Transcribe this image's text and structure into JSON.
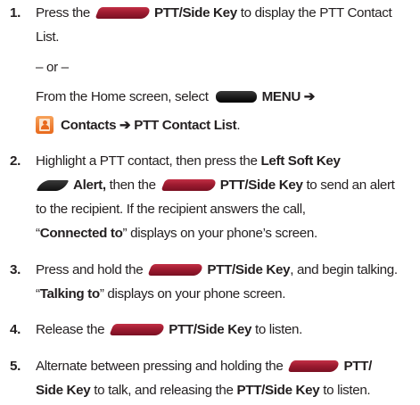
{
  "steps": [
    {
      "number": "1.",
      "line1_text": "Press the",
      "line1_bold": "PTT/Side Key",
      "line1_tail": "to display the PTT Contact",
      "line2": "List.",
      "or_text": "– or –",
      "alt_line1_text": "From the Home screen, select",
      "alt_line1_bold": "MENU ➔",
      "alt_line2_bold": "Contacts ➔ PTT Contact List",
      "alt_line2_tail": "."
    },
    {
      "number": "2.",
      "line1_text": "Highlight a PTT contact, then press the",
      "line1_bold": "Left Soft Key",
      "line2_bold1": "Alert,",
      "line2_text": "then the",
      "line2_bold2": "PTT/Side Key",
      "line2_tail": "to send an alert",
      "line3": "to the recipient. If the recipient answers the call,",
      "line4_q1": "“",
      "line4_bold": "Connected to",
      "line4_tail": "” displays on your phone’s screen."
    },
    {
      "number": "3.",
      "line1_text": "Press and hold the",
      "line1_bold": "PTT/Side Key",
      "line1_tail": ", and begin talking.",
      "line2_q1": "“",
      "line2_bold": "Talking to",
      "line2_tail": "” displays on your phone screen."
    },
    {
      "number": "4.",
      "line1_text": "Release the",
      "line1_bold": "PTT/Side Key",
      "line1_tail": "to listen."
    },
    {
      "number": "5.",
      "line1_text": "Alternate between pressing and holding the",
      "line1_bold": "PTT/",
      "line2_bold1": "Side Key",
      "line2_text": "to talk, and releasing the",
      "line2_bold2": "PTT/Side Key",
      "line2_tail": "to listen."
    }
  ],
  "icons": {
    "ptt_key": "ptt-side-key-icon",
    "menu_key": "menu-key-icon",
    "contacts": "contacts-icon",
    "soft_key": "left-soft-key-icon"
  },
  "colors": {
    "text": "#231f20",
    "ptt_key": "#9e1b30",
    "menu_key": "#1a1a1a",
    "contacts_icon": "#e8691c"
  }
}
